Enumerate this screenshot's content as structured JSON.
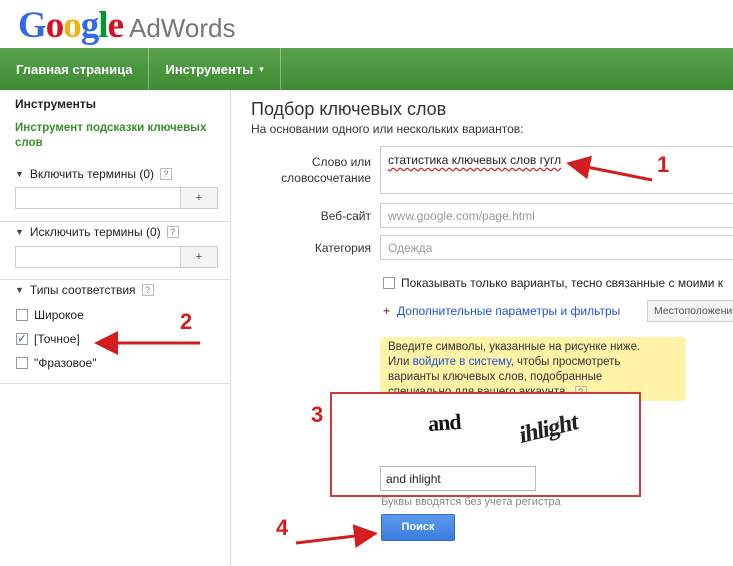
{
  "logo": {
    "google": "Google",
    "product": "AdWords"
  },
  "nav": {
    "home": "Главная страница",
    "tools": "Инструменты",
    "tools_arrow": "▾"
  },
  "sidebar": {
    "title": "Инструменты",
    "tool_link": "Инструмент подсказки ключевых слов",
    "include_terms": "Включить термины (0)",
    "exclude_terms": "Исключить термины (0)",
    "match_types": "Типы соответствия",
    "help": "?",
    "plus": "+",
    "match_options": [
      {
        "label": "Широкое",
        "checked": false
      },
      {
        "label": "[Точное]",
        "checked": true
      },
      {
        "label": "\"Фразовое\"",
        "checked": false
      }
    ]
  },
  "main": {
    "title": "Подбор ключевых слов",
    "subtitle": "На основании одного или нескольких вариантов:",
    "keyword_label_1": "Слово или",
    "keyword_label_2": "словосочетание",
    "keyword_value": "статистика ключевых слов гугл",
    "website_label": "Веб-сайт",
    "website_placeholder": "www.google.com/page.html",
    "category_label": "Категория",
    "category_placeholder": "Одежда",
    "close_variants": "Показывать только варианты, тесно связанные с моими к",
    "advanced_icon": "+",
    "advanced": "Дополнительные параметры и фильтры",
    "location": "Местоположени"
  },
  "notice": {
    "line1": "Введите символы, указанные на рисунке ниже.",
    "line2_pre": "Или ",
    "line2_link": "войдите в систему",
    "line2_post": ", чтобы просмотреть",
    "line3": "варианты ключевых слов, подобранные",
    "line4": "специально для вашего аккаунта."
  },
  "captcha": {
    "word1": "and",
    "word2": "ihlight",
    "input_value": "and ihlight",
    "note": "Буквы вводятся без учета регистра",
    "help": "?"
  },
  "search_button": "Поиск",
  "annotations": {
    "n1": "1",
    "n2": "2",
    "n3": "3",
    "n4": "4",
    "color": "#d21e1e"
  }
}
